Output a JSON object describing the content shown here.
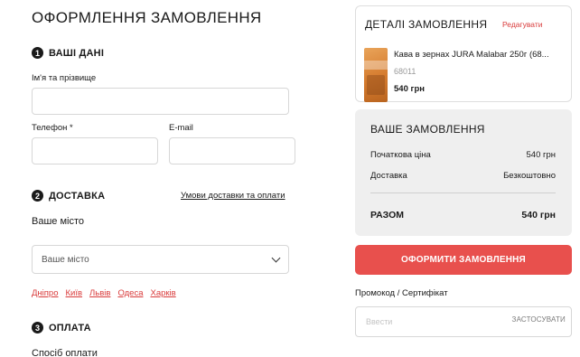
{
  "page": {
    "title": "ОФОРМЛЕННЯ ЗАМОВЛЕННЯ"
  },
  "personal": {
    "step": "1",
    "title": "ВАШІ ДАНІ",
    "name_label": "Ім'я та прізвище",
    "name_value": "",
    "phone_label": "Телефон *",
    "phone_value": "",
    "email_label": "E-mail",
    "email_value": ""
  },
  "delivery": {
    "step": "2",
    "title": "ДОСТАВКА",
    "terms_link": "Умови доставки та оплати",
    "city_label": "Ваше місто",
    "city_select_value": "Ваше місто",
    "quick_cities": [
      "Дніпро",
      "Київ",
      "Львів",
      "Одеса",
      "Харків"
    ]
  },
  "payment": {
    "step": "3",
    "title": "ОПЛАТА",
    "method_label": "Спосіб оплати"
  },
  "details": {
    "title": "ДЕТАЛІ ЗАМОВЛЕННЯ",
    "edit_label": "Редагувати",
    "product": {
      "name": "Кава в зернах JURA Malabar 250г (68...",
      "sku": "68011",
      "price": "540 грн"
    }
  },
  "summary": {
    "title": "ВАШЕ ЗАМОВЛЕННЯ",
    "initial_price_label": "Початкова ціна",
    "initial_price_value": "540 грн",
    "delivery_label": "Доставка",
    "delivery_value": "Безкоштовно",
    "total_label": "РАЗОМ",
    "total_value": "540 грн"
  },
  "order_button": {
    "label": "ОФОРМИТИ ЗАМОВЛЕННЯ"
  },
  "promo": {
    "label": "Промокод / Сертифікат",
    "placeholder": "Ввести",
    "apply_label": "ЗАСТОСУВАТИ"
  },
  "colors": {
    "accent": "#e8504d",
    "link_red": "#d93b3b",
    "summary_bg": "#efefef"
  }
}
